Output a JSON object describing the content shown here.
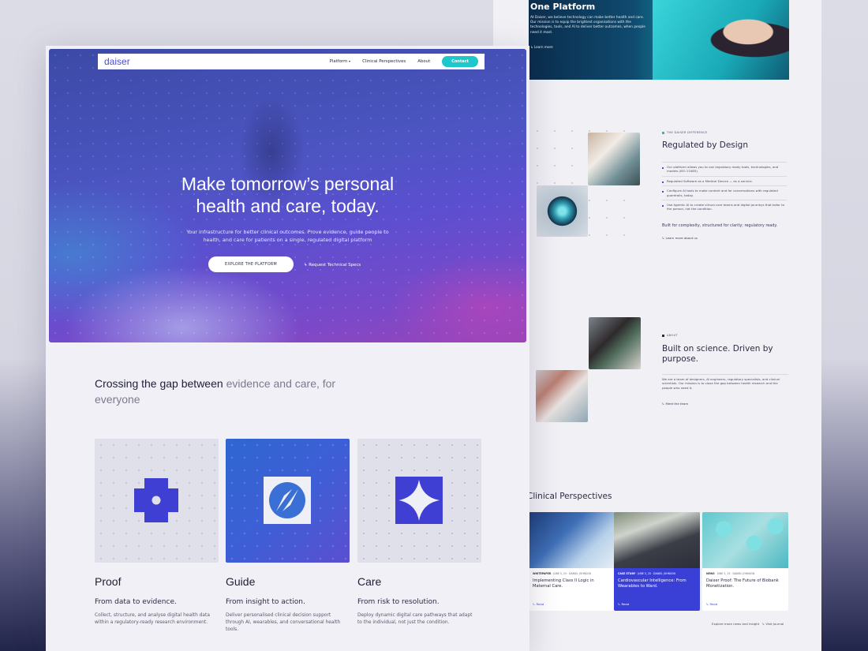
{
  "back": {
    "platform_title": "One Platform",
    "platform_text": "At Daiser, we believe technology can make better health and care. Our mission is to equip the brightest organisations with the technologies, tools, and AI to deliver better outcomes, when people need it most.",
    "platform_link": "↳ Learn more",
    "reg_eyebrow": "THE DAISER DIFFERENCE",
    "reg_title": "Regulated by Design",
    "reg_items": [
      "Our platform allows you to use regulatory ready tools, technologies, and models (ISO 13485).",
      "Regulated Software as a Medical Device — as a service.",
      "Configure AI tools to make content and for conversations with regulated guardrails, today.",
      "Use Agentic AI to create virtual care teams and digital journeys that tailor to the person, not the condition."
    ],
    "reg_sub": "Built for complexity, structured for clarity; regulatory ready.",
    "reg_link": "↳ Learn more about us",
    "about_eyebrow": "ABOUT",
    "about_title": "Built on science. Driven by purpose.",
    "about_text": "We are a team of designers, AI engineers, regulatory specialists, and clinical scientists. Our mission is to close the gap between health research and the people who need it.",
    "about_link": "↳ Meet the team",
    "cp_title": "Clinical Perspectives",
    "cards": [
      {
        "tag": "WHITEPAPER",
        "date": "JUNE 5, 25 · DANIEL JOHNSON",
        "title": "Implementing Class II Logic in Maternal Care.",
        "read": "↳ Read"
      },
      {
        "tag": "CASE STUDY",
        "date": "JUNE 5, 25 · DANIEL JOHNSON",
        "title": "Cardiovascular Intelligence: From Wearables to Ward.",
        "read": "↳ Read"
      },
      {
        "tag": "NEWS",
        "date": "JUNE 5, 25 · DANIEL JOHNSON",
        "title": "Daiser Proof: The Future of Biobank Monetization.",
        "read": "↳ Read"
      }
    ],
    "explore_text": "Explore more news and insight",
    "journal_link": "↳ Visit Journal"
  },
  "nav": {
    "logo": "daiser",
    "platform": "Platform",
    "perspectives": "Clinical Perspectives",
    "about": "About",
    "contact": "Contact"
  },
  "hero": {
    "title_line1": "Make tomorrow’s personal",
    "title_line2": "health and care, today.",
    "subtitle": "Your infrastructure for better clinical outcomes. Prove evidence, guide people to health, and care for patients on a single, regulated digital platform",
    "cta_primary": "EXPLORE THE PLATFORM",
    "cta_secondary": "↳ Request Technical Specs"
  },
  "intro": {
    "dark": "Crossing the gap between ",
    "muted": "evidence and care, for everyone"
  },
  "features": [
    {
      "title": "Proof",
      "subtitle": "From data to evidence.",
      "desc": "Collect, structure, and analyse digital health data within a regulatory-ready research environment."
    },
    {
      "title": "Guide",
      "subtitle": "From insight to action.",
      "desc": "Deliver personalised clinical decision support through AI, wearables, and conversational health tools."
    },
    {
      "title": "Care",
      "subtitle": "From risk to resolution.",
      "desc": "Deploy dynamic digital care pathways that adapt to the individual, not just the condition."
    }
  ],
  "colors": {
    "accent": "#4a4adf",
    "teal": "#1ec7cb",
    "dark": "#1e1e38"
  },
  "icons": [
    "proof-icon",
    "compass-icon",
    "sparkle-icon",
    "chevron-down-icon",
    "return-arrow-icon"
  ]
}
